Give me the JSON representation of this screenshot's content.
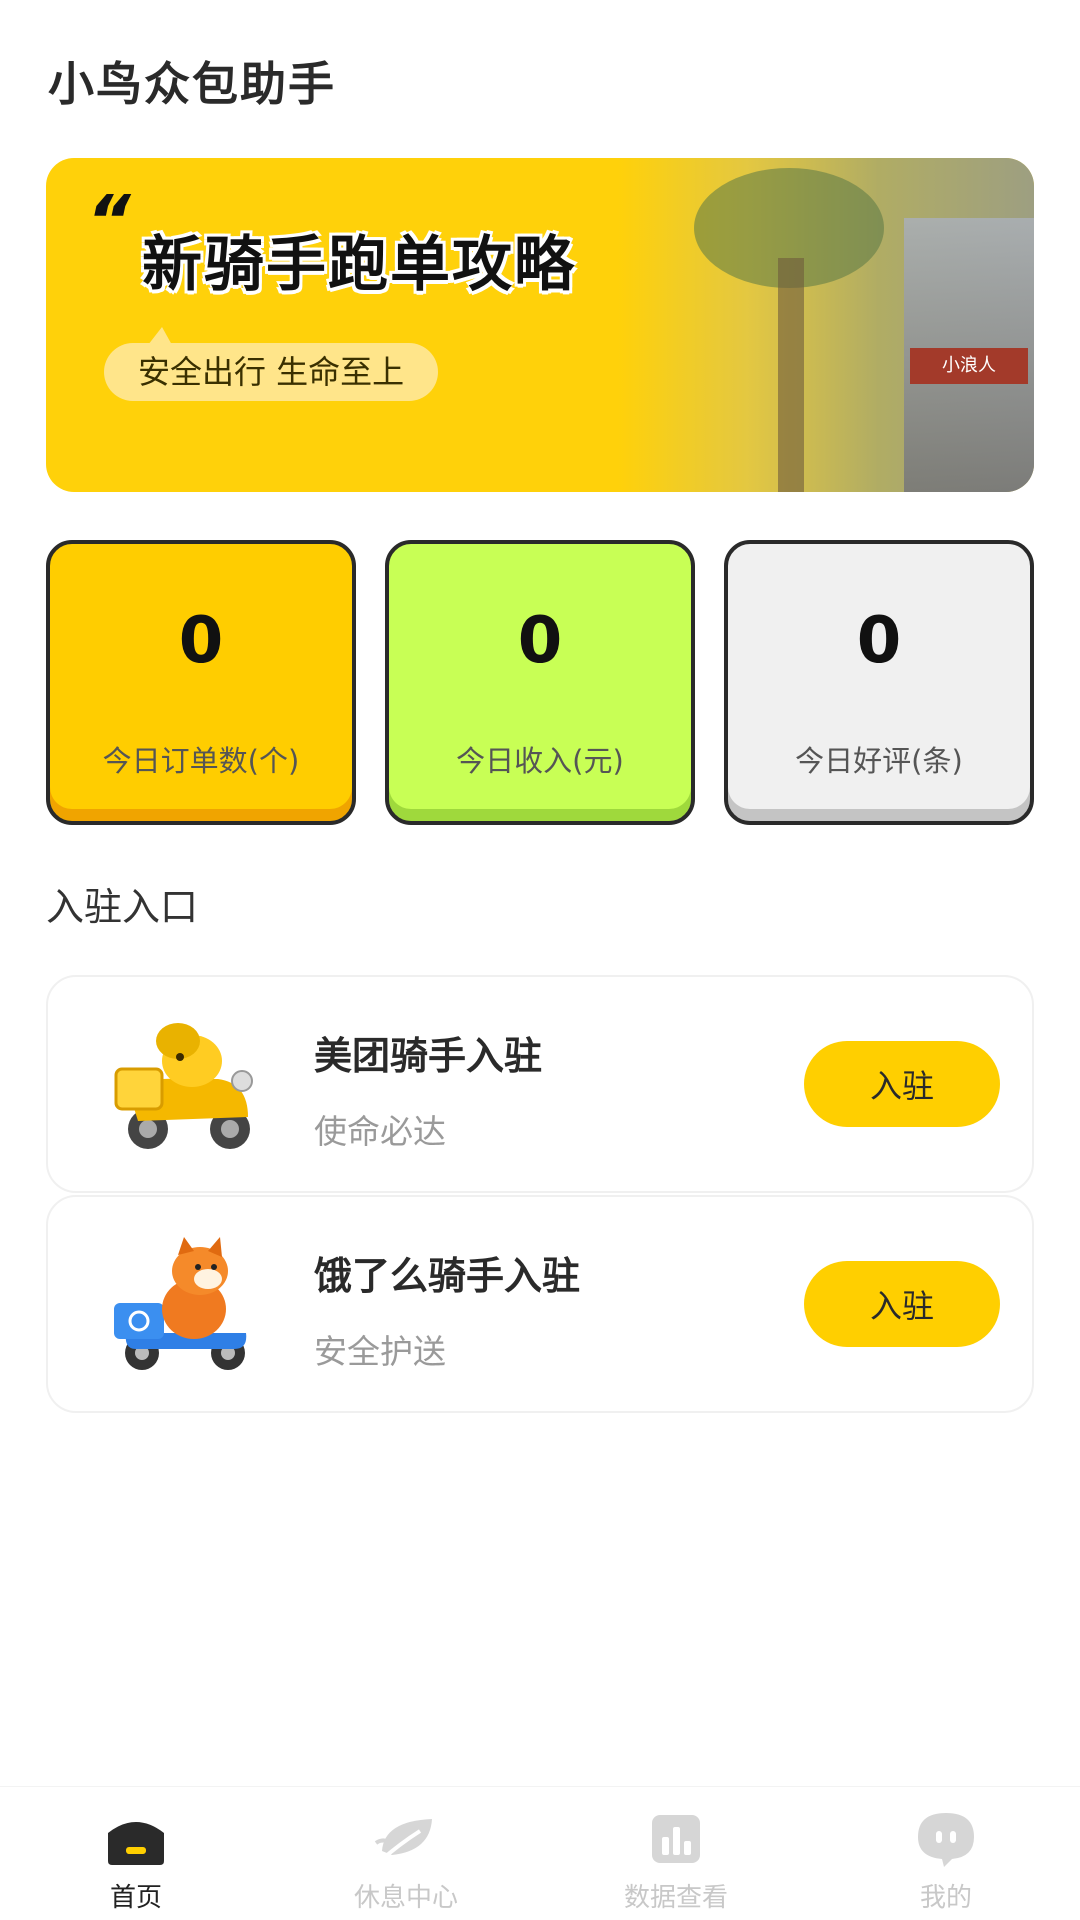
{
  "header": {
    "title": "小鸟众包助手"
  },
  "banner": {
    "quote_mark": "“",
    "headline": "新骑手跑单攻略",
    "subtitle": "安全出行 生命至上",
    "shop_sign": "小浪人"
  },
  "stats": [
    {
      "value": "0",
      "label": "今日订单数(个)",
      "color": "#ffcd00"
    },
    {
      "value": "0",
      "label": "今日收入(元)",
      "color": "#c8ff55"
    },
    {
      "value": "0",
      "label": "今日好评(条)",
      "color": "#f0f0f0"
    }
  ],
  "entry_section": {
    "title": "入驻入口"
  },
  "entries": [
    {
      "name": "美团骑手入驻",
      "desc": "使命必达",
      "button": "入驻",
      "icon": "yellow-kangaroo-scooter-icon"
    },
    {
      "name": "饿了么骑手入驻",
      "desc": "安全护送",
      "button": "入驻",
      "icon": "orange-shiba-blue-scooter-icon"
    }
  ],
  "nav": {
    "items": [
      {
        "label": "首页",
        "icon": "home-icon",
        "active": true
      },
      {
        "label": "休息中心",
        "icon": "leaf-icon",
        "active": false
      },
      {
        "label": "数据查看",
        "icon": "bar-chart-icon",
        "active": false
      },
      {
        "label": "我的",
        "icon": "chat-bubble-icon",
        "active": false
      }
    ]
  },
  "colors": {
    "accent": "#ffcf00",
    "lime": "#c8ff55",
    "text_dark": "#2a2a2a",
    "text_muted": "#9a9a9a"
  }
}
